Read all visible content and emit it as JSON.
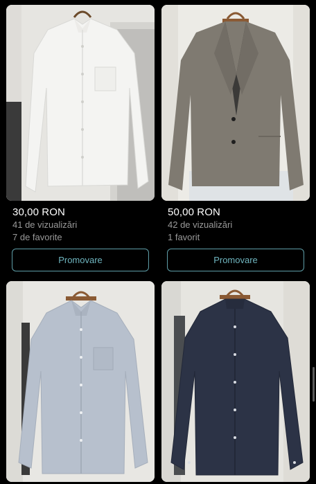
{
  "listings": [
    {
      "image": "white-linen-shirt-photo",
      "price": "30,00 RON",
      "views": "41 de vizualizări",
      "favorites": "7 de favorite",
      "promote_label": "Promovare"
    },
    {
      "image": "grey-blazer-photo",
      "price": "50,00 RON",
      "views": "42 de vizualizări",
      "favorites": "1 favorit",
      "promote_label": "Promovare"
    },
    {
      "image": "light-blue-shirt-photo"
    },
    {
      "image": "navy-band-collar-shirt-photo"
    }
  ],
  "colors": {
    "background": "#000000",
    "price_text": "#ffffff",
    "meta_text": "#9a9a9a",
    "button_border": "#5f9ea8",
    "button_text": "#6fb5bf"
  }
}
